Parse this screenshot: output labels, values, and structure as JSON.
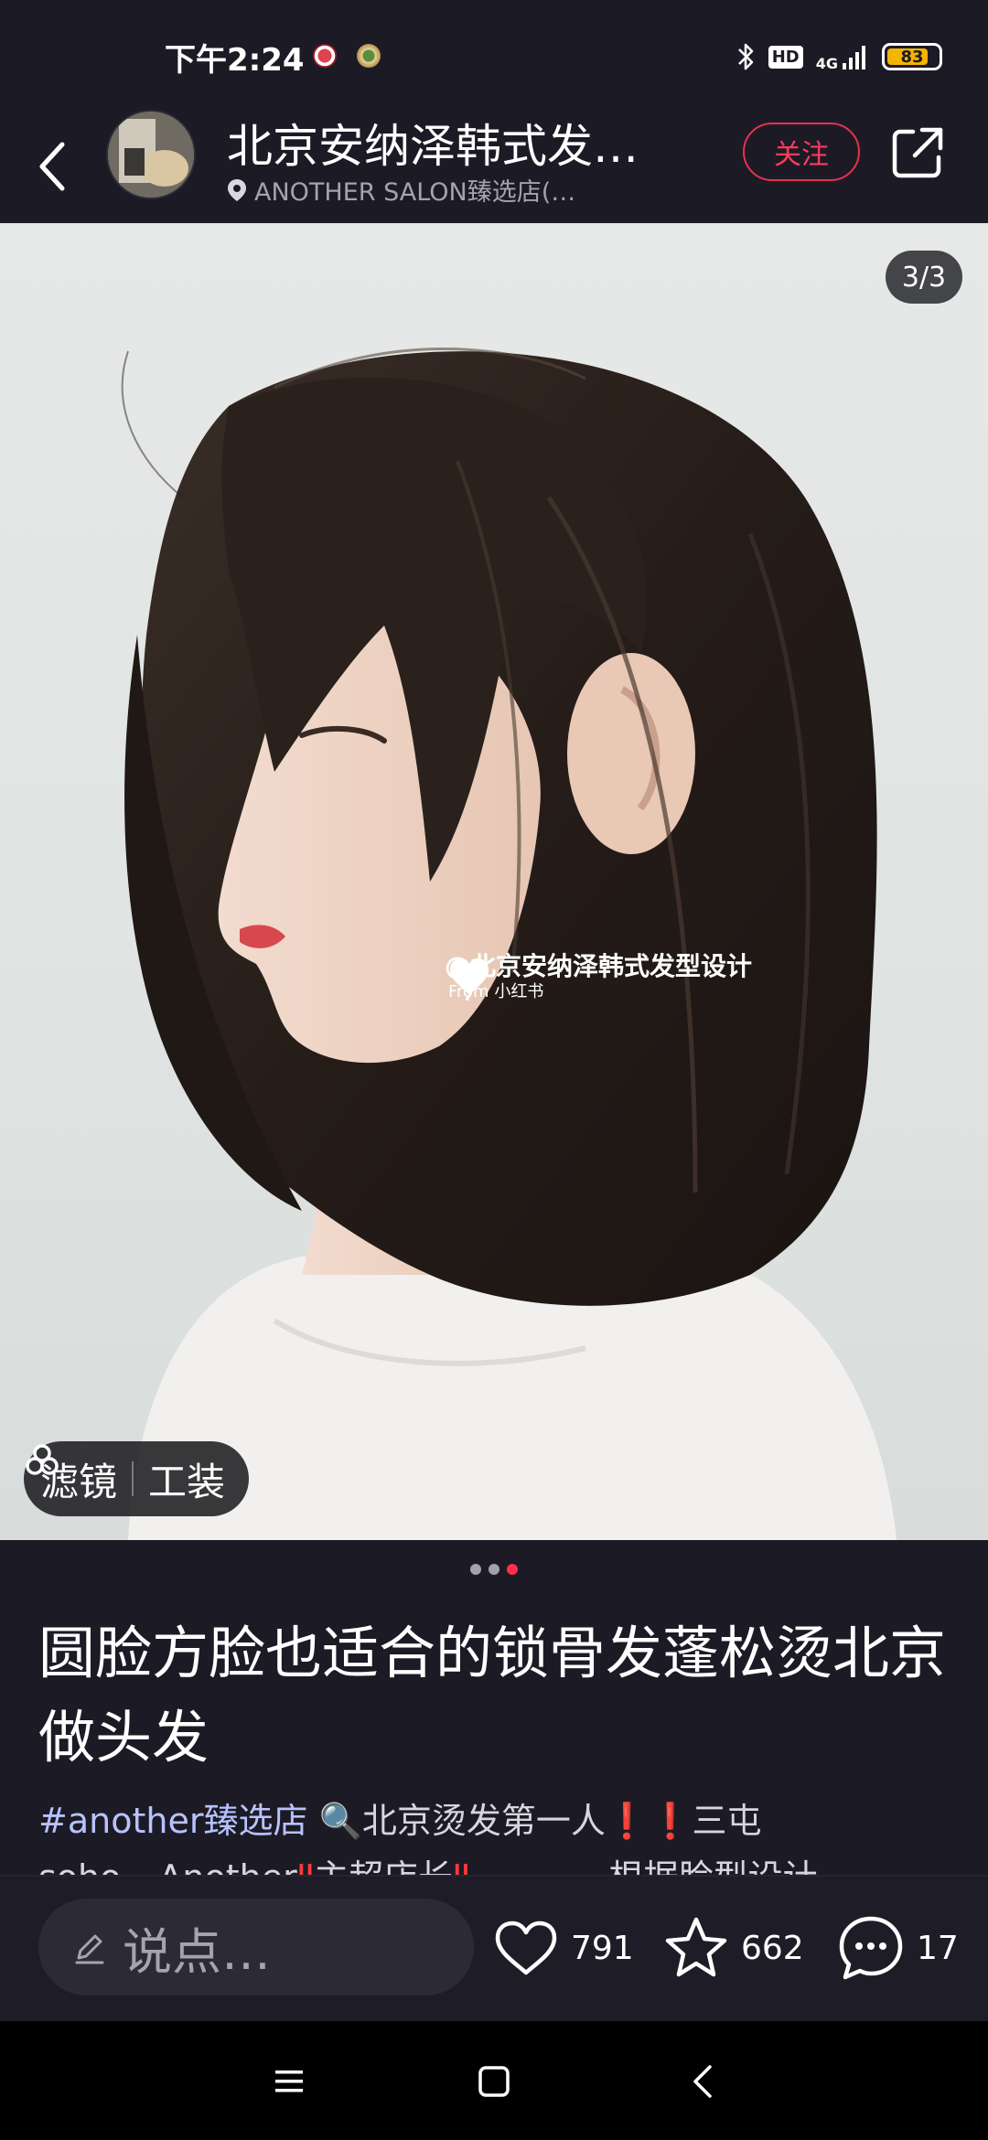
{
  "status_bar": {
    "time": "下午2:24",
    "hd_label": "HD",
    "network_label": "4G",
    "battery_level": "83",
    "battery_fraction": 0.83
  },
  "header": {
    "title": "北京安纳泽韩式发…",
    "location": "ANOTHER SALON臻选店(…",
    "follow_label": "关注",
    "icons": [
      "back-arrow-icon",
      "location-pin-icon",
      "share-icon"
    ]
  },
  "photo": {
    "counter": "3/3",
    "watermark_main": "@北京安纳泽韩式发型设计",
    "watermark_sub": "From 小红书",
    "filter_chip": {
      "filter_label": "滤镜",
      "tool_label": "工装"
    }
  },
  "carousel": {
    "total": 3,
    "active_index": 2
  },
  "post": {
    "title": "圆脸方脸也适合的锁骨发蓬松烫北京做头发",
    "body": {
      "tag": "#another臻选店",
      "line1_text": "北京烫发第一人",
      "line1_marks": "❗❗",
      "line1_tail": "三屯",
      "line2_a": "soho---Another",
      "line2_b": "主超店长",
      "line2_c": "————根据脸型设计"
    }
  },
  "action_bar": {
    "comment_placeholder": "说点…",
    "likes": "791",
    "stars": "662",
    "comments": "17",
    "accent_color": "#ff2e4d"
  }
}
